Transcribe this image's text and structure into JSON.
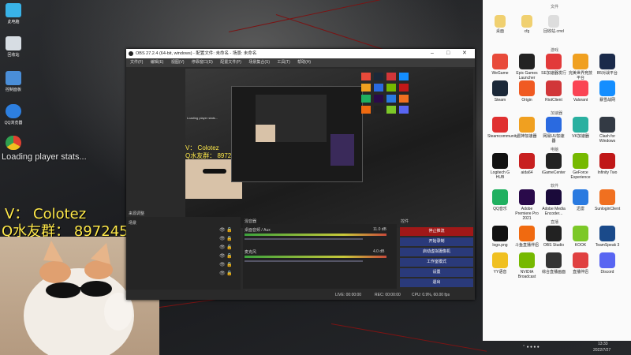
{
  "desktop_left": [
    {
      "label": "此电脑",
      "color": "#39b3e8"
    },
    {
      "label": "回收站",
      "color": "#d7dde3"
    },
    {
      "label": "控制面板",
      "color": "#4a8ed8"
    },
    {
      "label": "QQ浏览器",
      "color": "#2d7fe0"
    },
    {
      "label": "",
      "color": "#e8b53a"
    }
  ],
  "overlay": {
    "loading": "Loading player stats...",
    "v_line": "V：  Colotez",
    "q_line": "Q水友群：  897245162"
  },
  "obs": {
    "title": "OBS 27.2.4 (64-bit, windows) - 配置文件: 未命名 - 场景: 未命名",
    "menu": [
      "文件(F)",
      "编辑(E)",
      "视图(V)",
      "停靠窗口(D)",
      "配置文件(P)",
      "场景集合(S)",
      "工具(T)",
      "帮助(H)"
    ],
    "preview_caption": "Loading player stats...",
    "preview_v": "V：  Colotez",
    "preview_q": "Q水友群：  897245162",
    "sources_label": "来源调整",
    "scene_label": "场景",
    "mixer_label": "混音器",
    "mixer_tracks": [
      {
        "name": "桌面音频 / Aux",
        "level": "11.0 dB"
      },
      {
        "name": "麦克风",
        "level": "4.0 dB"
      }
    ],
    "controls_label": "控件",
    "controls": [
      "停止推流",
      "开始录制",
      "启动虚拟摄像机",
      "工作室模式",
      "设置",
      "退出"
    ],
    "status": {
      "live": "LIVE: 00:00:00",
      "rec": "REC: 00:00:00",
      "cpu": "CPU: 0.9%, 60.00 fps"
    }
  },
  "right_panel": {
    "top_label": "文件",
    "files": [
      "桌面",
      "cfg",
      "回收站.cmd"
    ],
    "groups": [
      {
        "label": "游戏",
        "items": [
          {
            "label": "WeGame",
            "color": "#e84a3a"
          },
          {
            "label": "Epic Games Launcher",
            "color": "#222222"
          },
          {
            "label": "SE加速器发行",
            "color": "#e23a3a"
          },
          {
            "label": "完美世界竞技平台",
            "color": "#f0a020"
          },
          {
            "label": "B5对战平台",
            "color": "#1a2a4a"
          },
          {
            "label": "Steam",
            "color": "#1b2838"
          },
          {
            "label": "Origin",
            "color": "#f05a22"
          },
          {
            "label": "RiotClient",
            "color": "#d13639"
          },
          {
            "label": "Valorant",
            "color": "#fa4454"
          },
          {
            "label": "暴雪战网",
            "color": "#148eff"
          }
        ]
      },
      {
        "label": "加速器",
        "items": [
          {
            "label": "Steamcommunity",
            "color": "#e03030"
          },
          {
            "label": "雷神加速器",
            "color": "#f0a020"
          },
          {
            "label": "网易UU加速器",
            "color": "#2a6ae0"
          },
          {
            "label": "VK加速器",
            "color": "#2ab0a0"
          },
          {
            "label": "Clash for Windows",
            "color": "#333a44"
          }
        ]
      },
      {
        "label": "电脑",
        "items": [
          {
            "label": "Logitech G HUB",
            "color": "#111111"
          },
          {
            "label": "aida64",
            "color": "#c82020"
          },
          {
            "label": "iGameCenter",
            "color": "#222222"
          },
          {
            "label": "GeForce Experience",
            "color": "#76b900"
          },
          {
            "label": "Infinity Two",
            "color": "#c01818"
          }
        ]
      },
      {
        "label": "软件",
        "items": [
          {
            "label": "QQ音乐",
            "color": "#20b060"
          },
          {
            "label": "Adobe Premiere Pro 2021",
            "color": "#2a0a4a"
          },
          {
            "label": "Adobe Media Encoder...",
            "color": "#1a0a3a"
          },
          {
            "label": "迅雷",
            "color": "#2a7ae0"
          },
          {
            "label": "SunloginClient",
            "color": "#f07020"
          }
        ]
      },
      {
        "label": "直播",
        "items": [
          {
            "label": "logo.png",
            "color": "#111111"
          },
          {
            "label": "斗鱼直播伴侣",
            "color": "#f06a10"
          },
          {
            "label": "OBS Studio",
            "color": "#222222"
          },
          {
            "label": "KOOK",
            "color": "#7cc828"
          },
          {
            "label": "TeamSpeak 3",
            "color": "#1a4a8a"
          },
          {
            "label": "YY语音",
            "color": "#f0c020"
          },
          {
            "label": "NVIDIA Broadcast",
            "color": "#76b900"
          },
          {
            "label": "综合直播画面",
            "color": "#333333"
          },
          {
            "label": "直播伴侣",
            "color": "#e04040"
          },
          {
            "label": "Discord",
            "color": "#5865f2"
          }
        ]
      }
    ]
  },
  "taskbar": {
    "time": "13:33",
    "date": "2022/7/27"
  }
}
